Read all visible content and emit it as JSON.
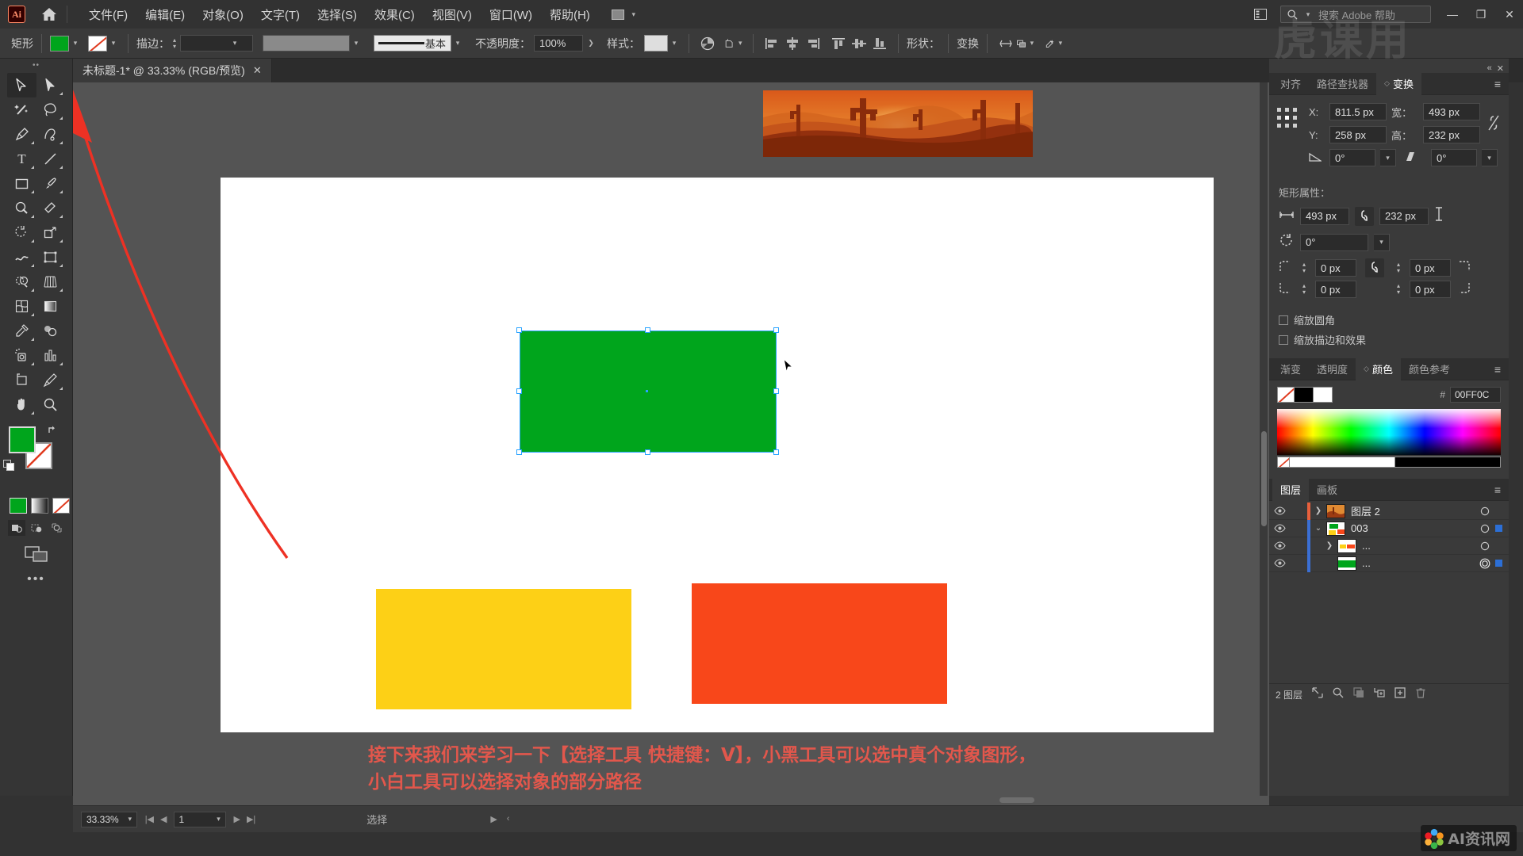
{
  "app": {
    "name": "Ai",
    "logo_label": "Ai"
  },
  "menubar": {
    "items": [
      {
        "label": "文件(F)",
        "name": "menu-file"
      },
      {
        "label": "编辑(E)",
        "name": "menu-edit"
      },
      {
        "label": "对象(O)",
        "name": "menu-object"
      },
      {
        "label": "文字(T)",
        "name": "menu-type"
      },
      {
        "label": "选择(S)",
        "name": "menu-select"
      },
      {
        "label": "效果(C)",
        "name": "menu-effect"
      },
      {
        "label": "视图(V)",
        "name": "menu-view"
      },
      {
        "label": "窗口(W)",
        "name": "menu-window"
      },
      {
        "label": "帮助(H)",
        "name": "menu-help"
      }
    ],
    "search_placeholder": "搜索 Adobe 帮助",
    "minimize": "—",
    "restore": "❐",
    "close": "✕"
  },
  "controlbar": {
    "object_label": "矩形",
    "fill_color": "#00a51c",
    "stroke_color": "none",
    "stroke_label": "描边：",
    "stroke_weight": "",
    "profile": "",
    "brush_label": "基本",
    "opacity_label": "不透明度：",
    "opacity_value": "100%",
    "style_label": "样式：",
    "shape_label": "形状：",
    "transform_label": "变换",
    "align_icons": [
      "align-left-icon",
      "align-center-h-icon",
      "align-right-icon",
      "align-top-icon",
      "align-center-v-icon",
      "align-bottom-icon"
    ]
  },
  "tab": {
    "title": "未标题-1* @ 33.33% (RGB/预览)",
    "close": "✕"
  },
  "toolbar": {
    "tools": [
      {
        "name": "selection-tool",
        "active": true
      },
      {
        "name": "direct-selection-tool",
        "active": false
      },
      {
        "name": "magic-wand-tool",
        "active": false
      },
      {
        "name": "lasso-tool",
        "active": false
      },
      {
        "name": "pen-tool",
        "active": false
      },
      {
        "name": "curvature-tool",
        "active": false
      },
      {
        "name": "type-tool",
        "active": false
      },
      {
        "name": "line-segment-tool",
        "active": false
      },
      {
        "name": "rectangle-tool",
        "active": false
      },
      {
        "name": "paintbrush-tool",
        "active": false
      },
      {
        "name": "shaper-tool",
        "active": false
      },
      {
        "name": "eraser-tool",
        "active": false
      },
      {
        "name": "rotate-tool",
        "active": false
      },
      {
        "name": "scale-tool",
        "active": false
      },
      {
        "name": "width-tool",
        "active": false
      },
      {
        "name": "free-transform-tool",
        "active": false
      },
      {
        "name": "shape-builder-tool",
        "active": false
      },
      {
        "name": "perspective-grid-tool",
        "active": false
      },
      {
        "name": "mesh-tool",
        "active": false
      },
      {
        "name": "gradient-tool",
        "active": false
      },
      {
        "name": "eyedropper-tool",
        "active": false
      },
      {
        "name": "blend-tool",
        "active": false
      },
      {
        "name": "symbol-sprayer-tool",
        "active": false
      },
      {
        "name": "column-graph-tool",
        "active": false
      },
      {
        "name": "artboard-tool",
        "active": false
      },
      {
        "name": "slice-tool",
        "active": false
      },
      {
        "name": "hand-tool",
        "active": false
      },
      {
        "name": "zoom-tool",
        "active": false
      }
    ],
    "fill_color": "#00a51c",
    "stroke_color": "#ffffff",
    "more_label": "•••"
  },
  "canvas": {
    "shapes": [
      {
        "name": "green-rectangle",
        "color": "#00a51c",
        "selected": true
      },
      {
        "name": "yellow-rectangle",
        "color": "#fdd016",
        "selected": false
      },
      {
        "name": "orange-rectangle",
        "color": "#f8471a",
        "selected": false
      }
    ],
    "placed_image_name": "desert-sunset-image",
    "annotation_line1": "接下来我们来学习一下【选择工具 快捷键：V】，小黑工具可以选中真个对象图形，",
    "annotation_line2": "小白工具可以选择对象的部分路径",
    "annotation_color": "#e2574c"
  },
  "transform_panel": {
    "tabs": [
      {
        "label": "对齐",
        "active": false
      },
      {
        "label": "路径查找器",
        "active": false
      },
      {
        "label": "变换",
        "active": true
      }
    ],
    "x_label": "X:",
    "x_value": "811.5 px",
    "y_label": "Y:",
    "y_value": "258 px",
    "w_label": "宽：",
    "w_value": "493 px",
    "h_label": "高：",
    "h_value": "232 px",
    "angle_value": "0°",
    "shear_value": "0°",
    "constrain_icon": "unlink-icon",
    "rect_section_title": "矩形属性：",
    "rect_width": "493 px",
    "rect_height": "232 px",
    "rect_rotation": "0°",
    "corner_tl": "0 px",
    "corner_tr": "0 px",
    "corner_bl": "0 px",
    "corner_br": "0 px",
    "checkbox_scale_corners": "缩放圆角",
    "checkbox_scale_strokes": "缩放描边和效果"
  },
  "color_panel": {
    "tabs": [
      {
        "label": "渐变",
        "active": false
      },
      {
        "label": "透明度",
        "active": false
      },
      {
        "label": "颜色",
        "active": true
      },
      {
        "label": "颜色参考",
        "active": false
      }
    ],
    "hex_prefix": "#",
    "hex_value": "00FF0C"
  },
  "layers_panel": {
    "tabs": [
      {
        "label": "图层",
        "active": true
      },
      {
        "label": "画板",
        "active": false
      }
    ],
    "rows": [
      {
        "name": "图层 2",
        "color": "#e8603c",
        "expanded": false,
        "indent": 0,
        "selected": false,
        "has_arrow": true,
        "target_filled": false,
        "thumb": "desert"
      },
      {
        "name": "003",
        "color": "#3b6fd4",
        "expanded": true,
        "indent": 0,
        "selected": false,
        "has_arrow": true,
        "target_filled": false,
        "thumb": "mixed"
      },
      {
        "name": "...",
        "color": "#3b6fd4",
        "expanded": false,
        "indent": 1,
        "selected": false,
        "has_arrow": true,
        "target_filled": false,
        "thumb": "warm"
      },
      {
        "name": "...",
        "color": "#3b6fd4",
        "expanded": false,
        "indent": 1,
        "selected": true,
        "has_arrow": false,
        "target_filled": true,
        "thumb": "green"
      }
    ],
    "footer_count": "2 图层",
    "footer_icons": [
      "locate-object-icon",
      "search-icon",
      "make-clipping-mask-icon",
      "create-sublayer-icon",
      "new-layer-icon",
      "delete-layer-icon"
    ]
  },
  "statusbar": {
    "zoom_value": "33.33%",
    "page_value": "1",
    "status_text": "选择",
    "first_page_icon": "first-page-icon",
    "prev_page_icon": "prev-page-icon",
    "next_page_icon": "next-page-icon",
    "last_page_icon": "last-page-icon"
  },
  "watermark": {
    "text": "AI资讯网",
    "overlay_text": "虎课用"
  }
}
